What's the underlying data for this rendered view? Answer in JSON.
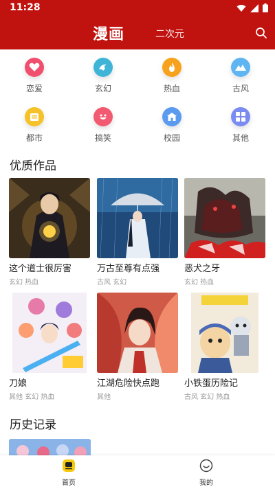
{
  "status_bar": {
    "time": "11:28"
  },
  "header": {
    "title": "漫画",
    "tab": "二次元"
  },
  "categories": [
    {
      "label": "恋爱",
      "icon": "heart-icon",
      "color": "#f0506e"
    },
    {
      "label": "玄幻",
      "icon": "dragon-icon",
      "color": "#3fb4d6"
    },
    {
      "label": "热血",
      "icon": "flame-icon",
      "color": "#f7a21d"
    },
    {
      "label": "古风",
      "icon": "mountain-icon",
      "color": "#5fb4f2"
    },
    {
      "label": "都市",
      "icon": "city-icon",
      "color": "#f6c22a"
    },
    {
      "label": "搞笑",
      "icon": "laugh-icon",
      "color": "#f25a72"
    },
    {
      "label": "校园",
      "icon": "school-icon",
      "color": "#5a9bf0"
    },
    {
      "label": "其他",
      "icon": "grid-icon",
      "color": "#7a8cf2"
    }
  ],
  "featured": {
    "title": "优质作品",
    "items": [
      {
        "title": "这个道士很厉害",
        "tags": "玄幻 热血"
      },
      {
        "title": "万古至尊有点强",
        "tags": "古风 玄幻"
      },
      {
        "title": "恶犬之牙",
        "tags": "玄幻 热血"
      },
      {
        "title": "刀娘",
        "tags": "其他 玄幻 热血"
      },
      {
        "title": "江湖危险快点跑",
        "tags": "其他"
      },
      {
        "title": "小铁蛋历险记",
        "tags": "古风 玄幻 热血"
      }
    ]
  },
  "history": {
    "title": "历史记录"
  },
  "bottom_nav": {
    "home": "首页",
    "mine": "我的"
  }
}
